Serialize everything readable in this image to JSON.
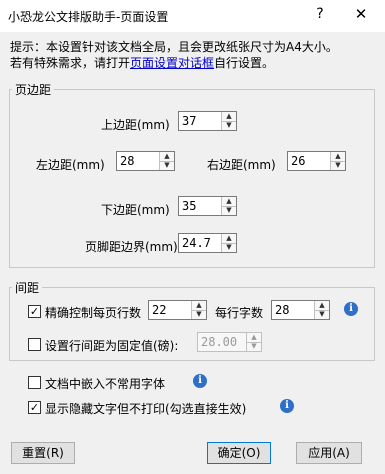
{
  "window": {
    "title": "小恐龙公文排版助手-页面设置",
    "help": "?",
    "close": "✕"
  },
  "hint": {
    "line1": "提示：本设置针对该文档全局，且会更改纸张尺寸为A4大小。",
    "line2_prefix": "若有特殊需求，请打开",
    "line2_link": "页面设置对话框",
    "line2_suffix": "自行设置。"
  },
  "margins": {
    "group_title": "页边距",
    "top_label": "上边距(mm)",
    "top_value": "37",
    "left_label": "左边距(mm)",
    "left_value": "28",
    "right_label": "右边距(mm)",
    "right_value": "26",
    "bottom_label": "下边距(mm)",
    "bottom_value": "35",
    "footer_label": "页脚距边界(mm)",
    "footer_value": "24.7"
  },
  "spacing": {
    "group_title": "间距",
    "precise_control_label": "精确控制每页行数",
    "precise_control_checked": true,
    "lines_value": "22",
    "chars_per_line_label": "每行字数",
    "chars_value": "28",
    "fixed_line_spacing_label": "设置行间距为固定值(磅):",
    "fixed_line_spacing_checked": false,
    "fixed_line_spacing_value": "28.00"
  },
  "options": {
    "embed_fonts_label": "文档中嵌入不常用字体",
    "embed_fonts_checked": false,
    "show_hidden_label": "显示隐藏文字但不打印(勾选直接生效)",
    "show_hidden_checked": true
  },
  "buttons": {
    "reset": "重置(R)",
    "ok": "确定(O)",
    "apply": "应用(A)"
  },
  "icons": {
    "info": "i",
    "check": "✓",
    "spin_up": "▲",
    "spin_down": "▼"
  }
}
